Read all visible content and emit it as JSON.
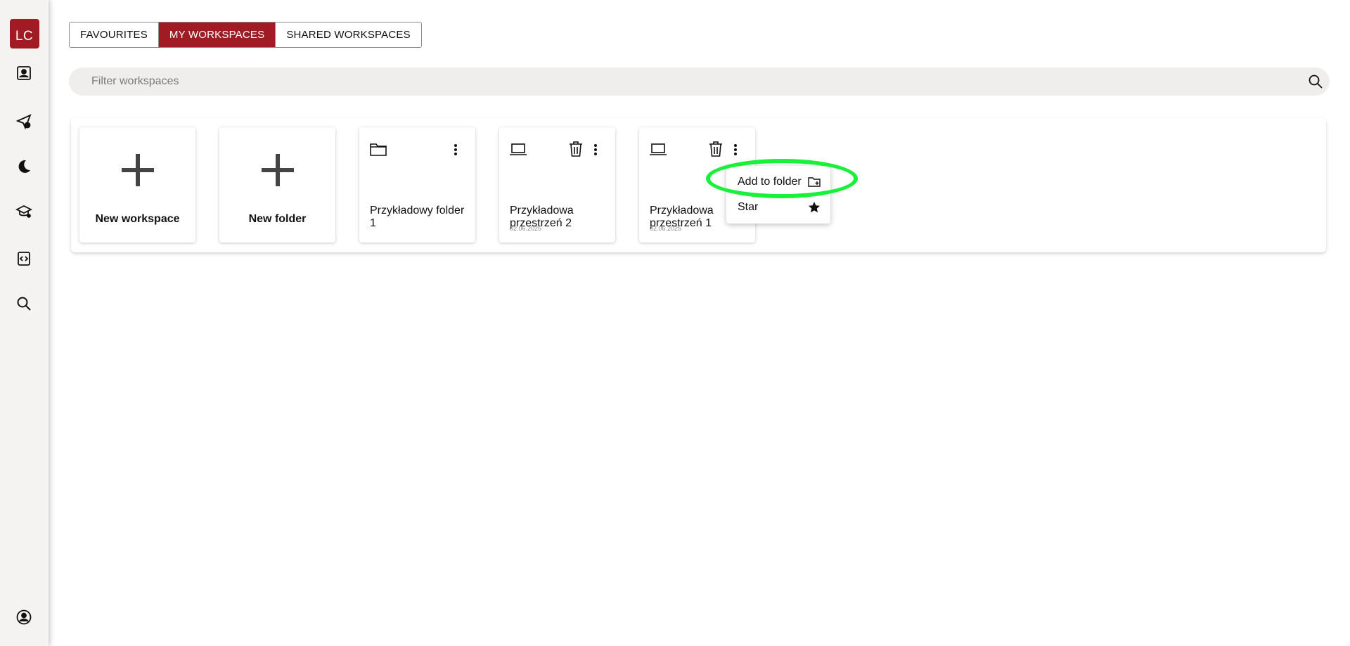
{
  "sidebar": {
    "user_initials": "LC",
    "icons": [
      "portrait-icon",
      "send-alert-icon",
      "moon-icon",
      "graduation-cap-icon",
      "code-file-icon",
      "search-icon",
      "account-circle-icon"
    ]
  },
  "tabs": [
    {
      "label": "FAVOURITES",
      "active": false
    },
    {
      "label": "MY WORKSPACES",
      "active": true
    },
    {
      "label": "SHARED WORKSPACES",
      "active": false
    }
  ],
  "filter": {
    "placeholder": "Filter workspaces"
  },
  "cards": {
    "new_workspace": {
      "label": "New workspace"
    },
    "new_folder": {
      "label": "New folder"
    },
    "folder1": {
      "name": "Przykładowy folder 1"
    },
    "workspace2": {
      "name": "Przykładowa przestrzeń 2",
      "date": "02.06.2025"
    },
    "workspace1": {
      "name": "Przykładowa przestrzeń 1",
      "date": "02.06.2025"
    }
  },
  "context_menu": {
    "add_to_folder": "Add to folder",
    "star": "Star"
  },
  "colors": {
    "accent": "#a11b24",
    "highlight": "#19f03a"
  }
}
